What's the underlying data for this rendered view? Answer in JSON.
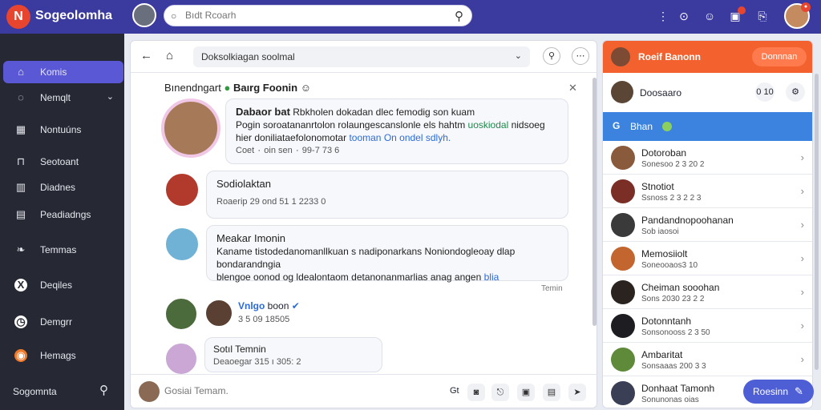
{
  "app": {
    "name": "Sogeolomha",
    "logo_letter": "N"
  },
  "search": {
    "placeholder": "Bıdt Rcoarh"
  },
  "top_icons": [
    "more-vertical-icon",
    "help-icon",
    "emoji-icon",
    "notification-icon",
    "share-icon"
  ],
  "sidebar": {
    "items": [
      {
        "label": "Komis",
        "icon": "home-icon",
        "active": true
      },
      {
        "label": "Nemqlt",
        "icon": "message-icon",
        "chevron": true
      },
      {
        "label": "Nontuúns",
        "icon": "grid-icon"
      },
      {
        "label": "Seotoant",
        "icon": "lock-icon"
      },
      {
        "label": "Diadnes",
        "icon": "calendar-icon"
      },
      {
        "label": "Peadiadngs",
        "icon": "document-icon"
      },
      {
        "label": "Temmas",
        "icon": "leaf-icon"
      },
      {
        "label": "Deqiles",
        "icon": "x-icon"
      },
      {
        "label": "Demgrr",
        "icon": "clock-icon"
      },
      {
        "label": "Hemags",
        "icon": "app-icon"
      }
    ],
    "footer_label": "Sogomnta"
  },
  "chat": {
    "search_text": "Doksolkiagan soolmal",
    "title": "Bınendngart",
    "title_name": "Baırg Foonin",
    "messages": [
      {
        "name": "Dabaor bat",
        "line1": "Rbkholen dokadan dlec femodig son kuam",
        "line2_a": "Pogin soroatananrtolon rolaungescanslonle els hahtm",
        "line2_tag": "uoskiodal",
        "line2_b": "nidsoeg",
        "line3_a": "hier doniliataefolonomotar",
        "line3_tag": "tooman",
        "line3_tag2": "On ondel sdlyh.",
        "meta": "Coet ٠ oin sen ٠ 99-7 73 6"
      },
      {
        "name": "Sodiolaktan",
        "meta": "Roaerip 29 ond 51 1 2233 0"
      },
      {
        "name": "Meakar Imonin",
        "line1": "Kaname tistodedanomanllkuan s nadiponarkans Noniondogleoay dlap bondarandngia",
        "line2_a": "blengoe oonod og ldealontaom detanonanmarlias anag angen",
        "line2_tag": "blia"
      },
      {
        "name": "Vnlgo",
        "name2": "boon",
        "meta": "3 5 09 18505"
      },
      {
        "name": "Sotıl Temnin",
        "meta": "Deaoegar 315 ı 305: 2"
      }
    ],
    "timestamp": "Temin",
    "compose_placeholder": "Gosiai Temam."
  },
  "right_panel": {
    "header_name": "Roeif Banonn",
    "header_button": "Donnnan",
    "sub_name": "Doosaaro",
    "sub_btn1": "0 10",
    "tab_label": "Bhan",
    "contacts": [
      {
        "name": "Dotoroban",
        "sub": "Sonesoo 2 3 20 2"
      },
      {
        "name": "Stnotiot",
        "sub": "Ssnoss 2 3 2 2 3"
      },
      {
        "name": "Pandandnopoohanan",
        "sub": "Sob iaosoi"
      },
      {
        "name": "Memosiiolt",
        "sub": "Soneooaos3 10"
      },
      {
        "name": "Cheiman sooohan",
        "sub": "Sons 2030 23 2 2"
      },
      {
        "name": "Dotonntanh",
        "sub": "Sonsonooss 2 3 50"
      },
      {
        "name": "Ambaritat",
        "sub": "Sonsaaas 200 3 3"
      },
      {
        "name": "Donhaat Tamonh",
        "sub": "Sonunonas oias"
      }
    ],
    "fab_label": "Roesinn"
  }
}
